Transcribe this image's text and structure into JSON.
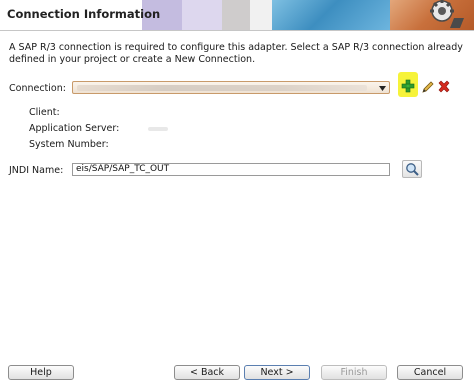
{
  "header": {
    "title": "Connection Information",
    "band_colors": [
      "#b9b1d8",
      "#d9d2ea",
      "#c9c6c6",
      "#ffffff",
      "#5aa1c9",
      "#d98a56"
    ]
  },
  "intro": {
    "text": "A SAP R/3 connection is required to configure this adapter. Select a SAP R/3 connection already defined in your project or create a New Connection."
  },
  "connection": {
    "label": "Connection:",
    "value": "",
    "icons": [
      "add-icon",
      "edit-pencil-icon",
      "delete-icon"
    ]
  },
  "details": {
    "client_label": "Client:",
    "client_value": "",
    "app_server_label": "Application Server:",
    "app_server_value": "",
    "system_number_label": "System Number:",
    "system_number_value": ""
  },
  "jndi": {
    "label": "JNDI Name:",
    "value": "eis/SAP/SAP_TC_OUT",
    "icon": "search-icon"
  },
  "footer": {
    "help": "Help",
    "back": "< Back",
    "next": "Next >",
    "finish": "Finish",
    "cancel": "Cancel"
  }
}
